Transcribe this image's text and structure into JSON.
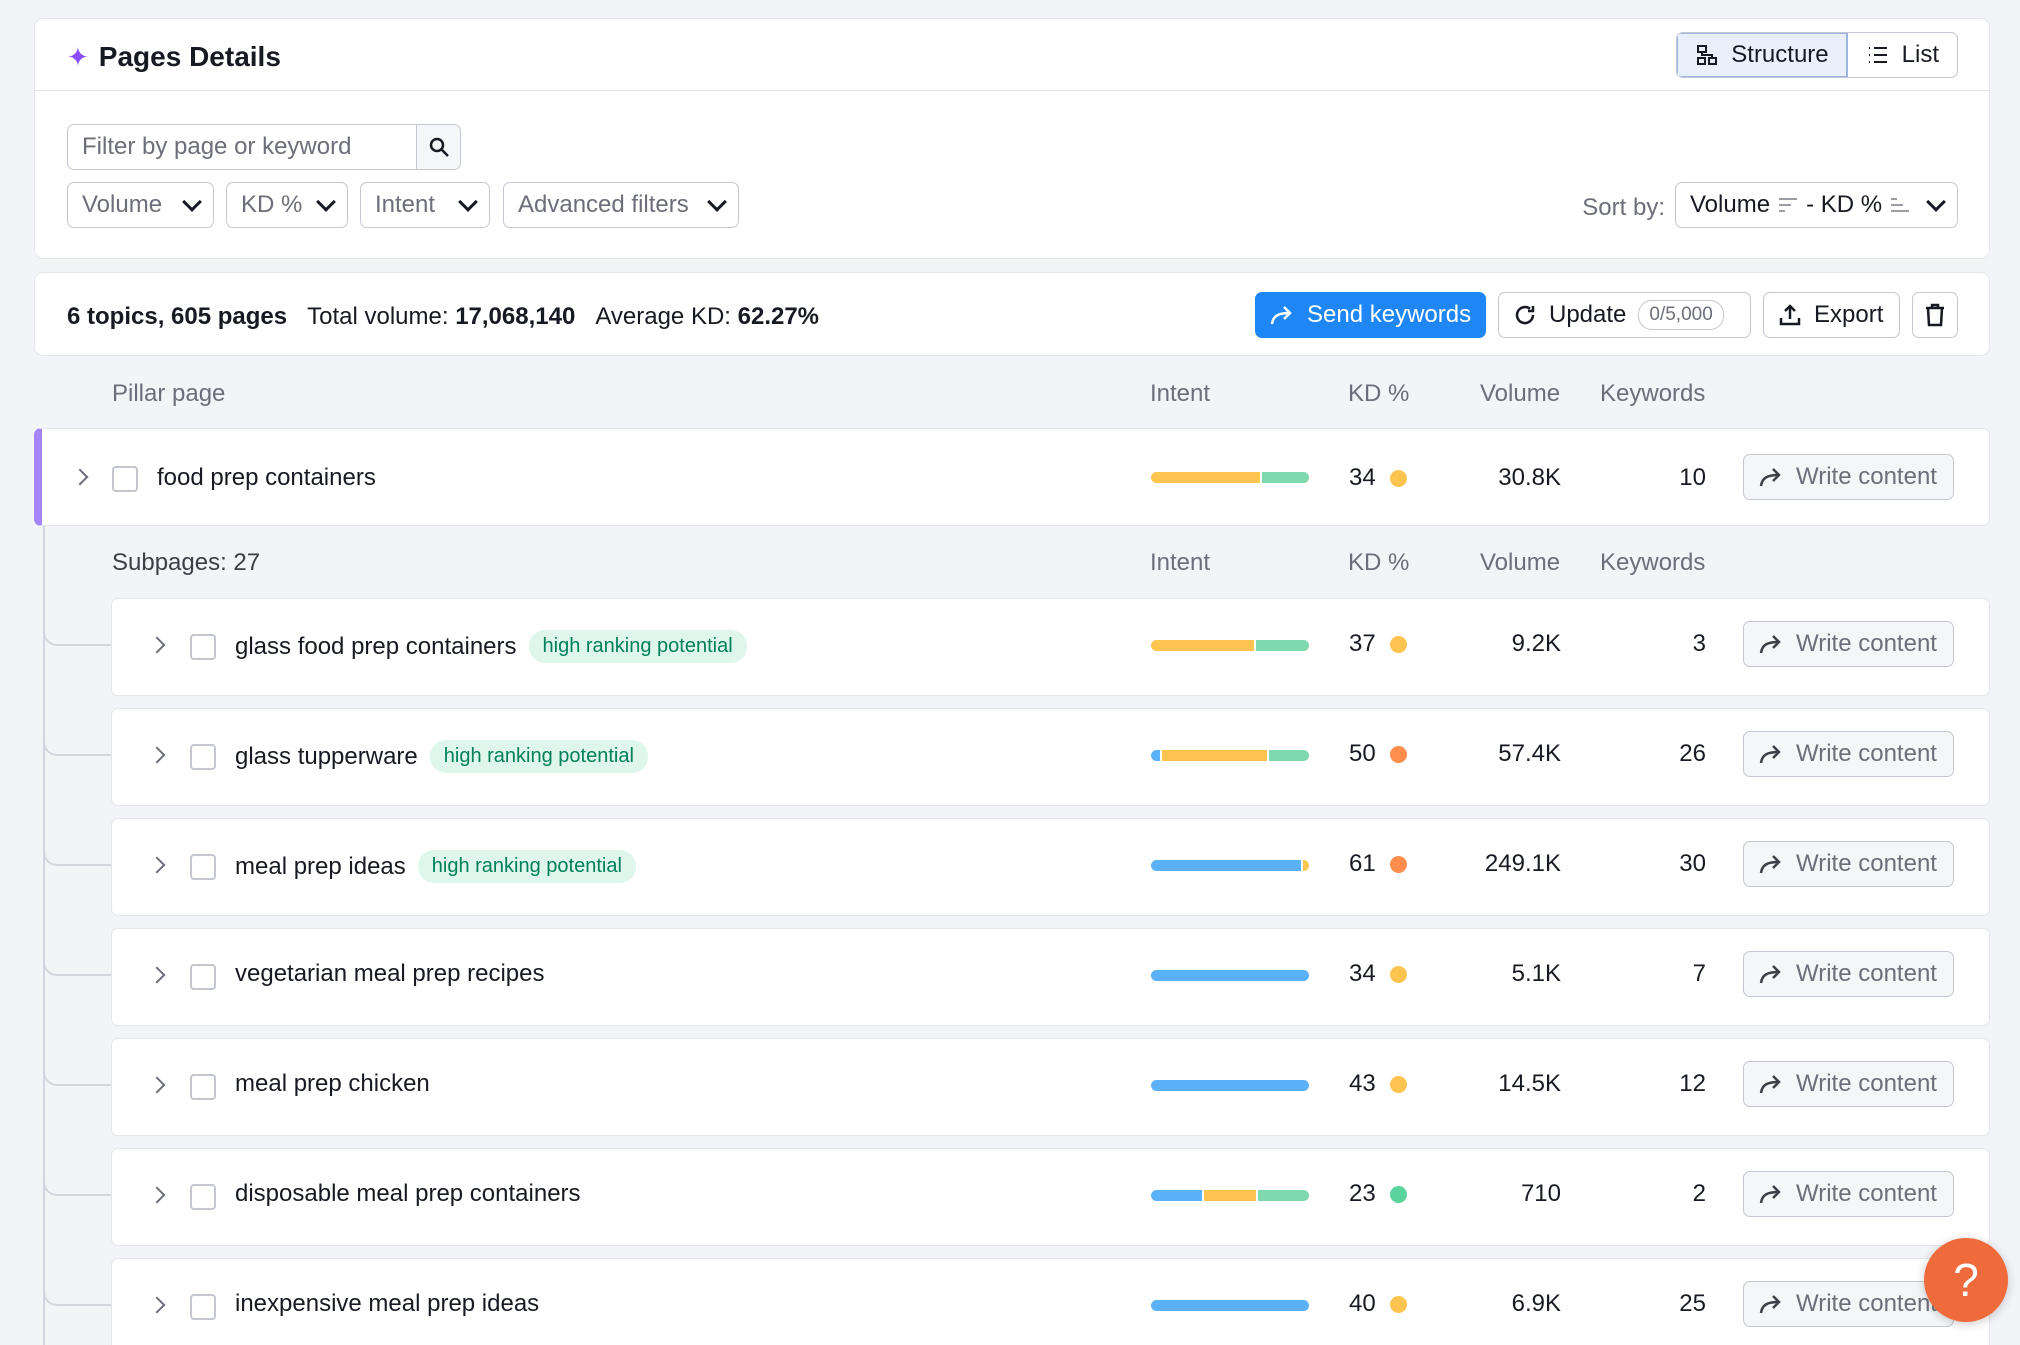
{
  "header": {
    "title": "Pages Details",
    "view_structure": "Structure",
    "view_list": "List"
  },
  "filters": {
    "search_placeholder": "Filter by page or keyword",
    "volume": "Volume",
    "kd": "KD %",
    "intent": "Intent",
    "advanced": "Advanced filters",
    "sort_label": "Sort by:",
    "sort_value": "Volume",
    "sort_sep": "- KD %"
  },
  "summary": {
    "topics_pages": "6 topics, 605 pages",
    "total_volume_label": "Total volume:",
    "total_volume": "17,068,140",
    "avg_kd_label": "Average KD:",
    "avg_kd": "62.27%",
    "send_keywords": "Send keywords",
    "update": "Update",
    "update_counter": "0/5,000",
    "export": "Export"
  },
  "columns": {
    "pillar": "Pillar page",
    "subpages": "Subpages: 27",
    "intent": "Intent",
    "kd": "KD %",
    "volume": "Volume",
    "keywords": "Keywords"
  },
  "write_label": "Write content",
  "badge_label": "high ranking potential",
  "colors": {
    "informational": "#5ab1f8",
    "commercial": "#fdc44f",
    "transactional": "#7ed9ae",
    "kd_easy": "#5ad49c",
    "kd_possible": "#fdc44f",
    "kd_hard": "#ff8d4e",
    "primary": "#1f87f5"
  },
  "pillar": {
    "name": "food prep containers",
    "kd": "34",
    "kd_color": "#fdc44f",
    "volume": "30.8K",
    "keywords": "10",
    "intent": [
      {
        "c": "#fdc44f",
        "w": 0.7
      },
      {
        "c": "#7ed9ae",
        "w": 0.3
      }
    ]
  },
  "subpages": [
    {
      "name": "glass food prep containers",
      "badge": true,
      "kd": "37",
      "kd_color": "#fdc44f",
      "volume": "9.2K",
      "keywords": "3",
      "intent": [
        {
          "c": "#fdc44f",
          "w": 0.66
        },
        {
          "c": "#7ed9ae",
          "w": 0.34
        }
      ]
    },
    {
      "name": "glass tupperware",
      "badge": true,
      "kd": "50",
      "kd_color": "#ff8d4e",
      "volume": "57.4K",
      "keywords": "26",
      "intent": [
        {
          "c": "#5ab1f8",
          "w": 0.06
        },
        {
          "c": "#fdc44f",
          "w": 0.68
        },
        {
          "c": "#7ed9ae",
          "w": 0.26
        }
      ]
    },
    {
      "name": "meal prep ideas",
      "badge": true,
      "kd": "61",
      "kd_color": "#ff8d4e",
      "volume": "249.1K",
      "keywords": "30",
      "intent": [
        {
          "c": "#5ab1f8",
          "w": 0.96
        },
        {
          "c": "#fdc44f",
          "w": 0.04
        }
      ]
    },
    {
      "name": "vegetarian meal prep recipes",
      "badge": false,
      "kd": "34",
      "kd_color": "#fdc44f",
      "volume": "5.1K",
      "keywords": "7",
      "intent": [
        {
          "c": "#5ab1f8",
          "w": 1.0
        }
      ]
    },
    {
      "name": "meal prep chicken",
      "badge": false,
      "kd": "43",
      "kd_color": "#fdc44f",
      "volume": "14.5K",
      "keywords": "12",
      "intent": [
        {
          "c": "#5ab1f8",
          "w": 1.0
        }
      ]
    },
    {
      "name": "disposable meal prep containers",
      "badge": false,
      "kd": "23",
      "kd_color": "#5ad49c",
      "volume": "710",
      "keywords": "2",
      "intent": [
        {
          "c": "#5ab1f8",
          "w": 0.33
        },
        {
          "c": "#fdc44f",
          "w": 0.34
        },
        {
          "c": "#7ed9ae",
          "w": 0.33
        }
      ]
    },
    {
      "name": "inexpensive meal prep ideas",
      "badge": false,
      "kd": "40",
      "kd_color": "#fdc44f",
      "volume": "6.9K",
      "keywords": "25",
      "intent": [
        {
          "c": "#5ab1f8",
          "w": 1.0
        }
      ]
    }
  ],
  "help_label": "?"
}
